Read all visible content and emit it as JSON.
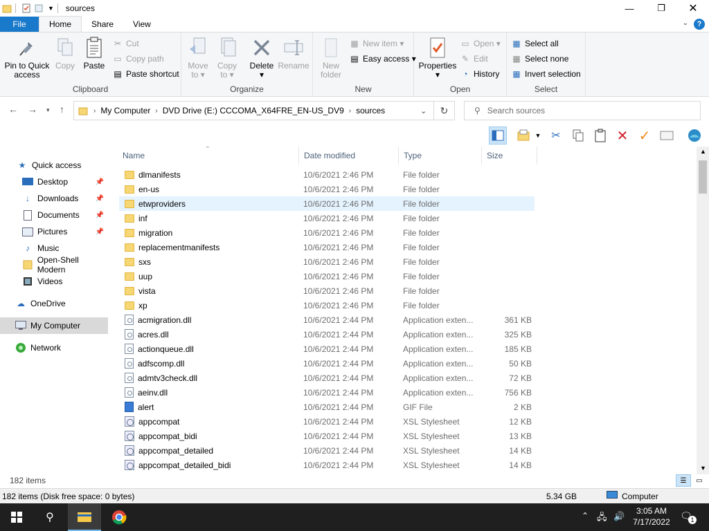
{
  "window": {
    "title": "sources"
  },
  "ribbon_tabs": [
    "File",
    "Home",
    "Share",
    "View"
  ],
  "clipboard": {
    "pin_label_1": "Pin to Quick",
    "pin_label_2": "access",
    "copy": "Copy",
    "paste": "Paste",
    "cut": "Cut",
    "copy_path": "Copy path",
    "paste_shortcut": "Paste shortcut",
    "group": "Clipboard"
  },
  "organize": {
    "move_to_1": "Move",
    "move_to_2": "to",
    "copy_to_1": "Copy",
    "copy_to_2": "to",
    "delete": "Delete",
    "rename": "Rename",
    "group": "Organize"
  },
  "new": {
    "new_folder_1": "New",
    "new_folder_2": "folder",
    "new_item": "New item",
    "easy_access": "Easy access",
    "group": "New"
  },
  "open": {
    "properties": "Properties",
    "open": "Open",
    "edit": "Edit",
    "history": "History",
    "group": "Open"
  },
  "select": {
    "select_all": "Select all",
    "select_none": "Select none",
    "invert": "Invert selection",
    "group": "Select"
  },
  "address": {
    "crumbs": [
      "My Computer",
      "DVD Drive (E:) CCCOMA_X64FRE_EN-US_DV9",
      "sources"
    ],
    "search_placeholder": "Search sources"
  },
  "nav": {
    "quick_access": "Quick access",
    "desktop": "Desktop",
    "downloads": "Downloads",
    "documents": "Documents",
    "pictures": "Pictures",
    "music": "Music",
    "openshell": "Open-Shell Modern",
    "videos": "Videos",
    "onedrive": "OneDrive",
    "mycomputer": "My Computer",
    "network": "Network"
  },
  "columns": {
    "name": "Name",
    "date": "Date modified",
    "type": "Type",
    "size": "Size"
  },
  "files": [
    {
      "name": "dlmanifests",
      "date": "10/6/2021 2:46 PM",
      "type": "File folder",
      "size": "",
      "icon": "folder"
    },
    {
      "name": "en-us",
      "date": "10/6/2021 2:46 PM",
      "type": "File folder",
      "size": "",
      "icon": "folder"
    },
    {
      "name": "etwproviders",
      "date": "10/6/2021 2:46 PM",
      "type": "File folder",
      "size": "",
      "icon": "folder"
    },
    {
      "name": "inf",
      "date": "10/6/2021 2:46 PM",
      "type": "File folder",
      "size": "",
      "icon": "folder"
    },
    {
      "name": "migration",
      "date": "10/6/2021 2:46 PM",
      "type": "File folder",
      "size": "",
      "icon": "folder"
    },
    {
      "name": "replacementmanifests",
      "date": "10/6/2021 2:46 PM",
      "type": "File folder",
      "size": "",
      "icon": "folder"
    },
    {
      "name": "sxs",
      "date": "10/6/2021 2:46 PM",
      "type": "File folder",
      "size": "",
      "icon": "folder"
    },
    {
      "name": "uup",
      "date": "10/6/2021 2:46 PM",
      "type": "File folder",
      "size": "",
      "icon": "folder"
    },
    {
      "name": "vista",
      "date": "10/6/2021 2:46 PM",
      "type": "File folder",
      "size": "",
      "icon": "folder"
    },
    {
      "name": "xp",
      "date": "10/6/2021 2:46 PM",
      "type": "File folder",
      "size": "",
      "icon": "folder"
    },
    {
      "name": "acmigration.dll",
      "date": "10/6/2021 2:44 PM",
      "type": "Application exten...",
      "size": "361 KB",
      "icon": "dll"
    },
    {
      "name": "acres.dll",
      "date": "10/6/2021 2:44 PM",
      "type": "Application exten...",
      "size": "325 KB",
      "icon": "dll"
    },
    {
      "name": "actionqueue.dll",
      "date": "10/6/2021 2:44 PM",
      "type": "Application exten...",
      "size": "185 KB",
      "icon": "dll"
    },
    {
      "name": "adfscomp.dll",
      "date": "10/6/2021 2:44 PM",
      "type": "Application exten...",
      "size": "50 KB",
      "icon": "dll"
    },
    {
      "name": "admtv3check.dll",
      "date": "10/6/2021 2:44 PM",
      "type": "Application exten...",
      "size": "72 KB",
      "icon": "dll"
    },
    {
      "name": "aeinv.dll",
      "date": "10/6/2021 2:44 PM",
      "type": "Application exten...",
      "size": "756 KB",
      "icon": "dll"
    },
    {
      "name": "alert",
      "date": "10/6/2021 2:44 PM",
      "type": "GIF File",
      "size": "2 KB",
      "icon": "gif"
    },
    {
      "name": "appcompat",
      "date": "10/6/2021 2:44 PM",
      "type": "XSL Stylesheet",
      "size": "12 KB",
      "icon": "xsl"
    },
    {
      "name": "appcompat_bidi",
      "date": "10/6/2021 2:44 PM",
      "type": "XSL Stylesheet",
      "size": "13 KB",
      "icon": "xsl"
    },
    {
      "name": "appcompat_detailed",
      "date": "10/6/2021 2:44 PM",
      "type": "XSL Stylesheet",
      "size": "14 KB",
      "icon": "xsl"
    },
    {
      "name": "appcompat_detailed_bidi",
      "date": "10/6/2021 2:44 PM",
      "type": "XSL Stylesheet",
      "size": "14 KB",
      "icon": "xsl"
    }
  ],
  "status": {
    "item_count": "182 items",
    "disk_info": "182 items (Disk free space: 0 bytes)",
    "size_total": "5.34 GB",
    "location": "Computer"
  },
  "taskbar": {
    "time": "3:05 AM",
    "date": "7/17/2022",
    "notifications": "1"
  },
  "colors": {
    "accent": "#1979ca",
    "folder": "#f7d774",
    "selection": "#e5f3ff",
    "taskbar": "#1f1f1f"
  }
}
